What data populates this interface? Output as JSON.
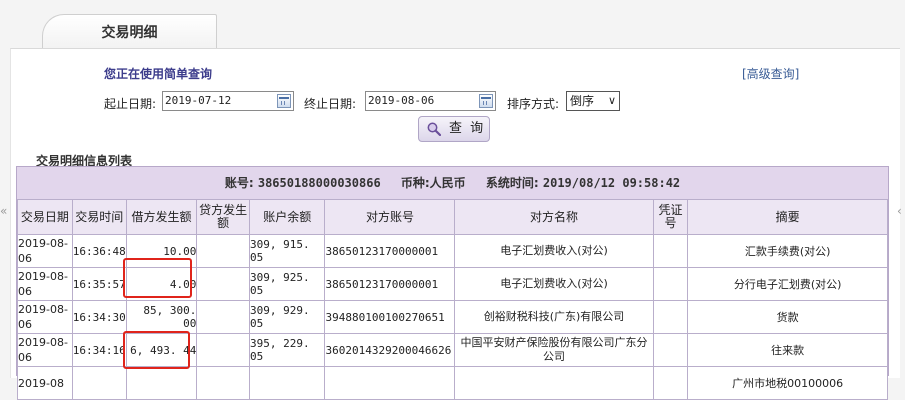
{
  "tab": {
    "label": "交易明细"
  },
  "query": {
    "title": "您正在使用简单查询",
    "advanced_link": "[高级查询]",
    "start_label": "起止日期:",
    "start_value": "2019-07-12",
    "end_label": "终止日期:",
    "end_value": "2019-08-06",
    "sort_label": "排序方式:",
    "sort_value": "倒序",
    "button_label": "查 询"
  },
  "list": {
    "title": "交易明细信息列表"
  },
  "info": {
    "account_label": "账号:",
    "account_value": "38650188000030866",
    "currency_label": "币种:",
    "currency_value": "人民币",
    "systime_label": "系统时间:",
    "systime_value": "2019/08/12 09:58:42"
  },
  "columns": [
    "交易日期",
    "交易时间",
    "借方发生额",
    "贷方发生额",
    "账户余额",
    "对方账号",
    "对方名称",
    "凭证号",
    "摘要"
  ],
  "rows": [
    {
      "date": "2019-08-06",
      "time": "16:36:48",
      "debit": "10.00",
      "credit": "",
      "balance": "309, 915. 05",
      "cp_account": "38650123170000001",
      "cp_name": "电子汇划费收入(对公)",
      "voucher": "",
      "memo": "汇款手续费(对公)"
    },
    {
      "date": "2019-08-06",
      "time": "16:35:57",
      "debit": "4.00",
      "credit": "",
      "balance": "309, 925. 05",
      "cp_account": "38650123170000001",
      "cp_name": "电子汇划费收入(对公)",
      "voucher": "",
      "memo": "分行电子汇划费(对公)"
    },
    {
      "date": "2019-08-06",
      "time": "16:34:30",
      "debit": "85, 300. 00",
      "credit": "",
      "balance": "309, 929. 05",
      "cp_account": "394880100100270651",
      "cp_name": "创裕财税科技(广东)有限公司",
      "voucher": "",
      "memo": "货款"
    },
    {
      "date": "2019-08-06",
      "time": "16:34:16",
      "debit": "6, 493. 44",
      "credit": "",
      "balance": "395, 229. 05",
      "cp_account": "3602014329200046626",
      "cp_name": "中国平安财产保险股份有限公司广东分公司",
      "voucher": "",
      "memo": "往来款"
    },
    {
      "date": "2019-08",
      "time": "",
      "debit": "",
      "credit": "",
      "balance": "",
      "cp_account": "",
      "cp_name": "",
      "voucher": "",
      "memo": "广州市地税00100006"
    }
  ],
  "icons": {
    "calendar": "calendar-icon",
    "search": "magnifier-icon",
    "dropdown": "chevron-down-icon",
    "left": "double-left-arrow-icon",
    "right": "double-right-arrow-icon"
  },
  "colors": {
    "accent": "#3d3d8c",
    "table_header_bg": "#e2d6ec",
    "highlight": "#e0241b"
  }
}
